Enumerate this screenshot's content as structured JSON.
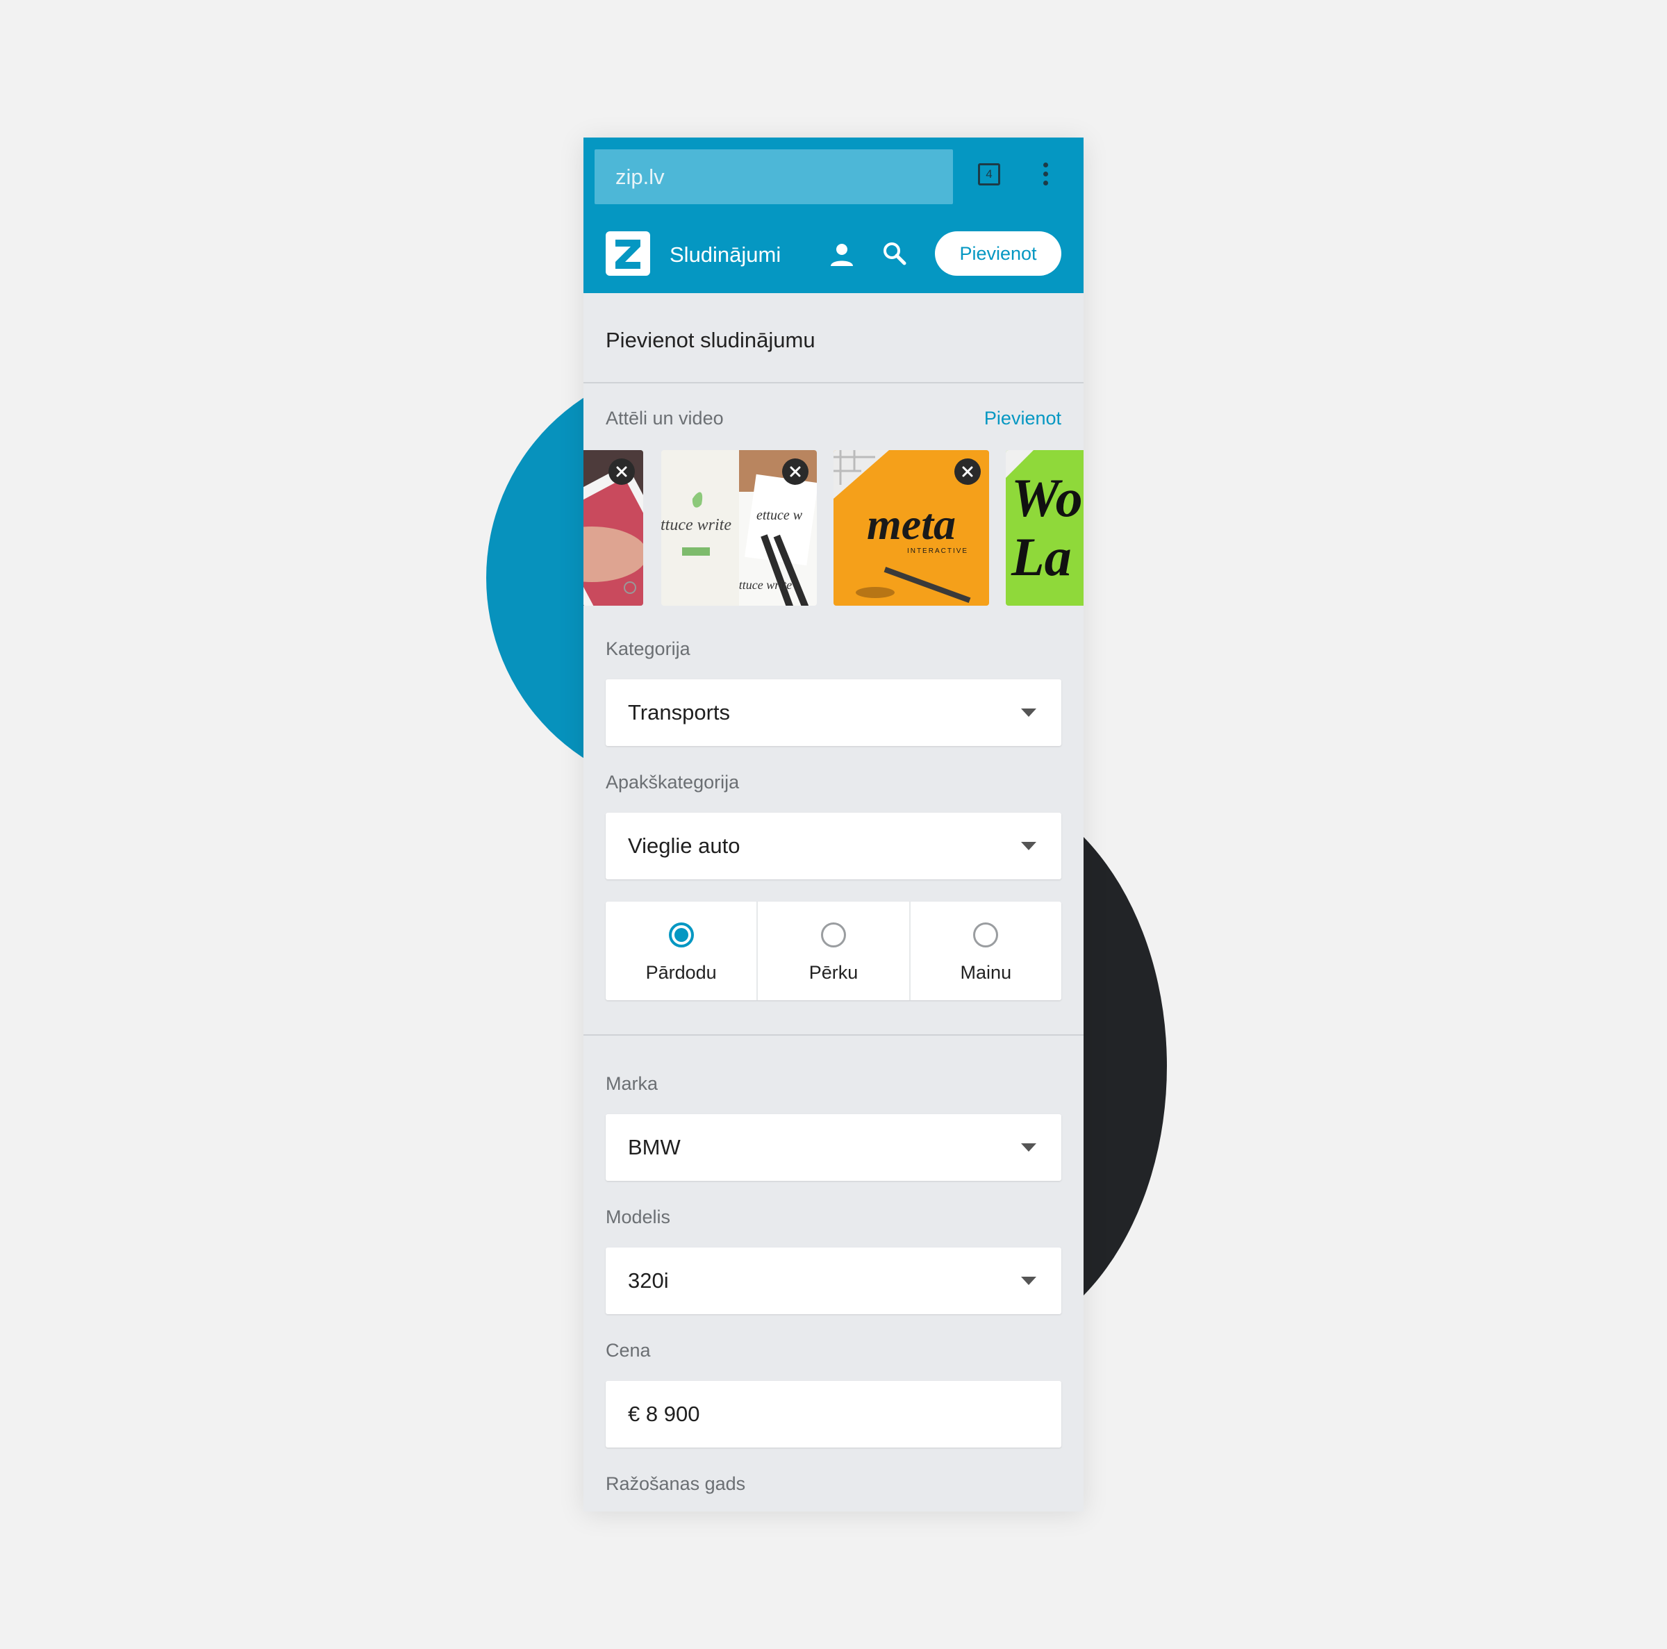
{
  "browser": {
    "url": "zip.lv",
    "tab_count": "4"
  },
  "header": {
    "brand": "Sludinājumi",
    "add_button": "Pievienot"
  },
  "page": {
    "title": "Pievienot sludinājumu"
  },
  "media": {
    "label": "Attēli un video",
    "add_link": "Pievienot"
  },
  "category": {
    "label": "Kategorija",
    "value": "Transports"
  },
  "subcategory": {
    "label": "Apakškategorija",
    "value": "Vieglie auto"
  },
  "deal_type": {
    "options": [
      "Pārdodu",
      "Pērku",
      "Mainu"
    ],
    "selected": "Pārdodu"
  },
  "brand_field": {
    "label": "Marka",
    "value": "BMW"
  },
  "model_field": {
    "label": "Modelis",
    "value": "320i"
  },
  "price_field": {
    "label": "Cena",
    "value": "€ 8 900"
  },
  "year_field": {
    "label": "Ražošanas gads"
  },
  "colors": {
    "accent": "#0597c2",
    "dark_circle": "#222427",
    "page_bg": "#f2f2f2",
    "form_bg": "#e8eaed"
  }
}
